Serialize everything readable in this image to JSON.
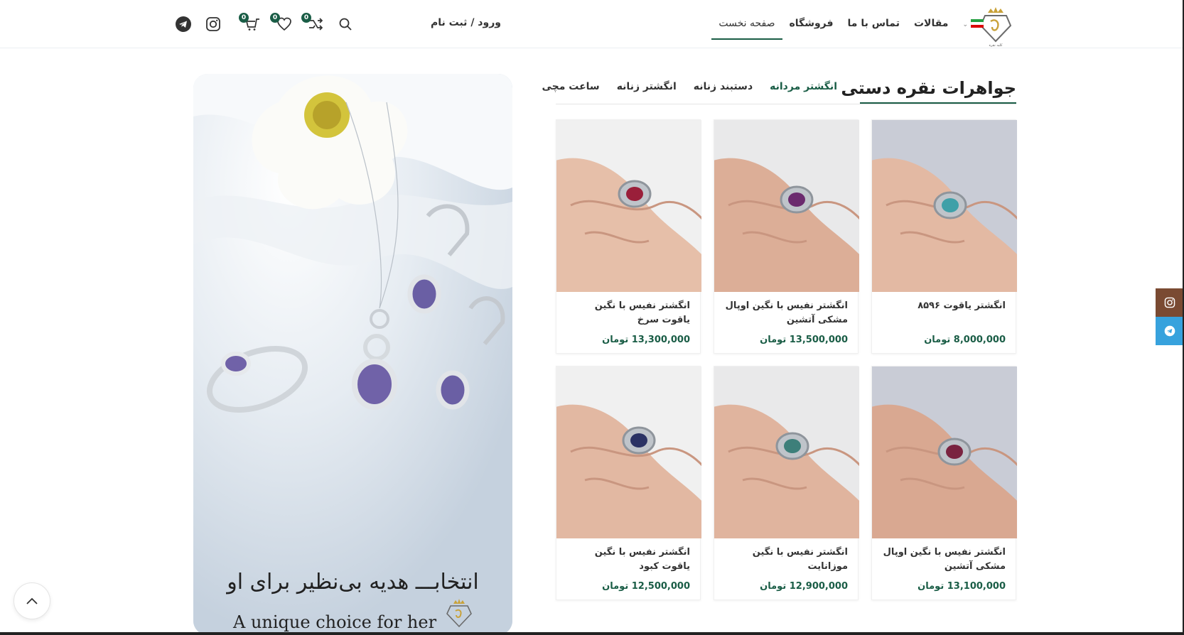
{
  "header": {
    "nav": [
      {
        "label": "صفحه نخست",
        "active": true
      },
      {
        "label": "فروشگاه",
        "active": false
      },
      {
        "label": "تماس با ما",
        "active": false
      },
      {
        "label": "مقالات",
        "active": false
      }
    ],
    "account_label": "ورود / ثبت نام",
    "badges": {
      "compare": "0",
      "wishlist": "0",
      "cart": "0"
    }
  },
  "section": {
    "title": "جواهرات نقره دستی",
    "tabs": [
      {
        "label": "انگشتر مردانه",
        "active": true
      },
      {
        "label": "دستبند زنانه",
        "active": false
      },
      {
        "label": "انگشتر زنانه",
        "active": false
      },
      {
        "label": "ساعت مچی",
        "active": false
      }
    ]
  },
  "products": [
    {
      "title": "انگشتر یاقوت ۸۵۹۶",
      "price": "8,000,000 تومان",
      "stone": "#3fa0a8"
    },
    {
      "title": "انگشتر نفیس با نگین اوپال مشکی آتشین",
      "price": "13,500,000 تومان",
      "stone": "#6b2a6e"
    },
    {
      "title": "انگشتر نفیس با نگین یاقوت سرخ",
      "price": "13,300,000 تومان",
      "stone": "#9a1f3a"
    },
    {
      "title": "انگشتر نفیس با نگین اوپال مشکی آتشین",
      "price": "13,100,000 تومان",
      "stone": "#7a2340"
    },
    {
      "title": "انگشتر نفیس با نگین موزانایت",
      "price": "12,900,000 تومان",
      "stone": "#3d7f7a"
    },
    {
      "title": "انگشتر نفیس با نگین یاقوت کبود",
      "price": "12,500,000 تومان",
      "stone": "#2b3264"
    }
  ],
  "banner": {
    "text_fa": "انتخابـــ هدیه بی‌نظیر برای او",
    "text_en": "A unique choice for her"
  },
  "colors": {
    "accent": "#1a5d46",
    "instagram_side": "#7a4a32",
    "telegram_side": "#37a2dd"
  },
  "icons": [
    "logo",
    "search-icon",
    "compare-icon",
    "heart-icon",
    "cart-icon",
    "instagram-icon",
    "telegram-icon",
    "chevron-up-icon",
    "iran-flag-icon"
  ]
}
